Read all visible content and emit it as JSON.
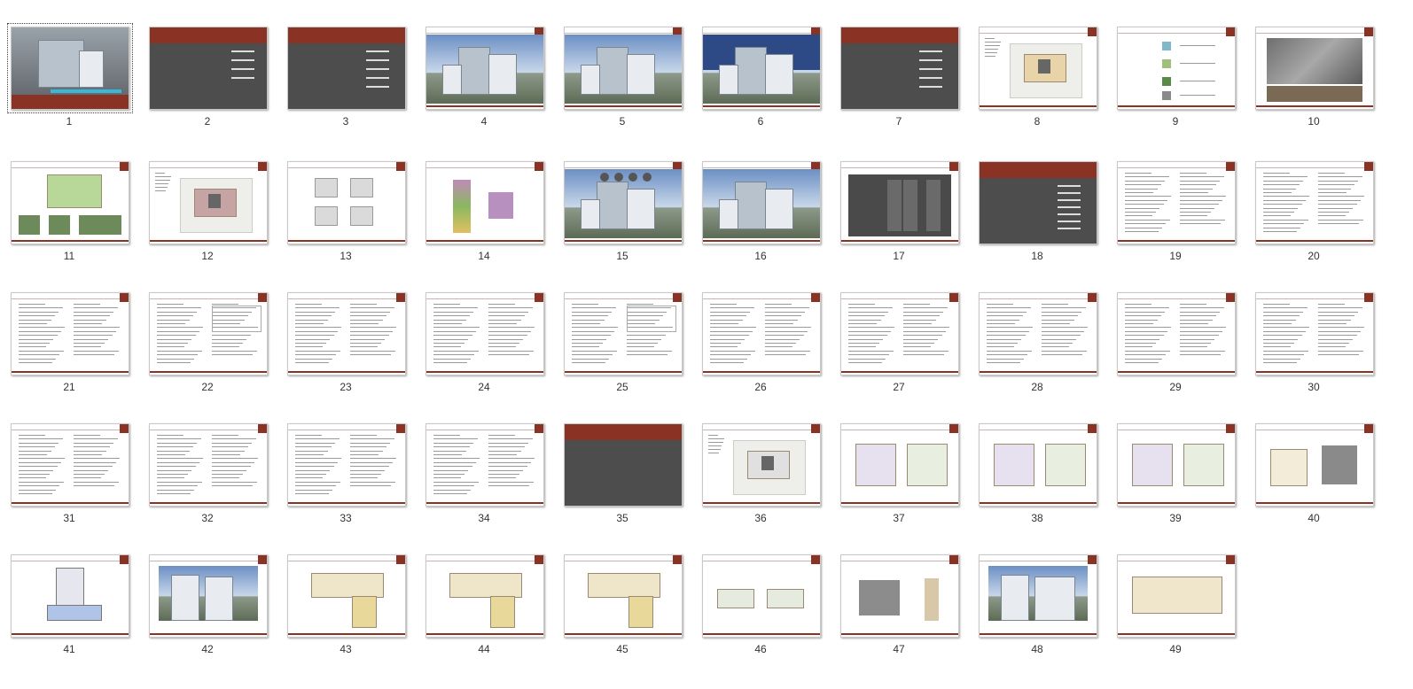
{
  "slides": [
    {
      "n": "1",
      "type": "cover"
    },
    {
      "n": "2",
      "type": "index"
    },
    {
      "n": "3",
      "type": "section"
    },
    {
      "n": "4",
      "type": "render-aerial"
    },
    {
      "n": "5",
      "type": "render-street"
    },
    {
      "n": "6",
      "type": "render-dusk"
    },
    {
      "n": "7",
      "type": "section"
    },
    {
      "n": "8",
      "type": "siteplan"
    },
    {
      "n": "9",
      "type": "diagram-icons"
    },
    {
      "n": "10",
      "type": "aerial-photo"
    },
    {
      "n": "11",
      "type": "site-analysis"
    },
    {
      "n": "12",
      "type": "siteplan-color"
    },
    {
      "n": "13",
      "type": "massing"
    },
    {
      "n": "14",
      "type": "massing-3d"
    },
    {
      "n": "15",
      "type": "render-circles"
    },
    {
      "n": "16",
      "type": "render-detail"
    },
    {
      "n": "17",
      "type": "material-board"
    },
    {
      "n": "18",
      "type": "section"
    },
    {
      "n": "19",
      "type": "text"
    },
    {
      "n": "20",
      "type": "text"
    },
    {
      "n": "21",
      "type": "text"
    },
    {
      "n": "22",
      "type": "text-table"
    },
    {
      "n": "23",
      "type": "text"
    },
    {
      "n": "24",
      "type": "text"
    },
    {
      "n": "25",
      "type": "text-table"
    },
    {
      "n": "26",
      "type": "text"
    },
    {
      "n": "27",
      "type": "text"
    },
    {
      "n": "28",
      "type": "text"
    },
    {
      "n": "29",
      "type": "text"
    },
    {
      "n": "30",
      "type": "text"
    },
    {
      "n": "31",
      "type": "text"
    },
    {
      "n": "32",
      "type": "text"
    },
    {
      "n": "33",
      "type": "text"
    },
    {
      "n": "34",
      "type": "text"
    },
    {
      "n": "35",
      "type": "section-bottom"
    },
    {
      "n": "36",
      "type": "siteplan-gray"
    },
    {
      "n": "37",
      "type": "floorplan-two"
    },
    {
      "n": "38",
      "type": "floorplan-two"
    },
    {
      "n": "39",
      "type": "floorplan-two"
    },
    {
      "n": "40",
      "type": "floorplan-roof"
    },
    {
      "n": "41",
      "type": "section-drawing"
    },
    {
      "n": "42",
      "type": "elevation-render"
    },
    {
      "n": "43",
      "type": "floorplan-wide"
    },
    {
      "n": "44",
      "type": "floorplan-wide"
    },
    {
      "n": "45",
      "type": "floorplan-wide"
    },
    {
      "n": "46",
      "type": "floorplan-pair"
    },
    {
      "n": "47",
      "type": "floorplan-gray"
    },
    {
      "n": "48",
      "type": "elevation-long"
    },
    {
      "n": "49",
      "type": "floorplan-big"
    }
  ],
  "selected": "1",
  "colors": {
    "accent": "#8a3224",
    "dark": "#4d4d4d",
    "border": "#c9c9c9"
  }
}
